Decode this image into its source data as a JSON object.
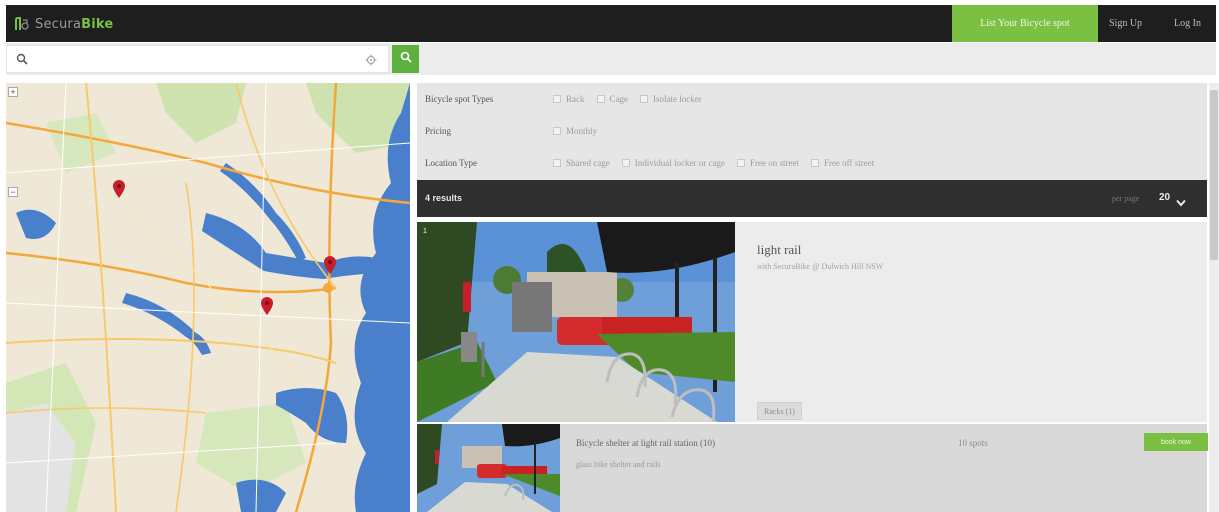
{
  "header": {
    "brand_light": "Secura",
    "brand_bold": "Bike",
    "cta_label": "List Your Bicycle spot",
    "signup_label": "Sign Up",
    "login_label": "Log In"
  },
  "search": {
    "value": "",
    "placeholder": ""
  },
  "filters": {
    "types": {
      "label": "Bicycle spot Types",
      "options": [
        "Rack",
        "Cage",
        "Isolate locker"
      ]
    },
    "pricing": {
      "label": "Pricing",
      "options": [
        "Monthly"
      ]
    },
    "location": {
      "label": "Location Type",
      "options": [
        "Shared cage",
        "Individual locker or cage",
        "Free on street",
        "Free off street"
      ]
    }
  },
  "results": {
    "count_label": "4 results",
    "per_page_label": "per page",
    "per_page_value": "20"
  },
  "listings": [
    {
      "index": "1",
      "title": "light rail",
      "subtitle": "with SecuraBike @ Dulwich Hill NSW",
      "tag": "Racks (1)"
    },
    {
      "title": "Bicycle shelter at light rail station (10)",
      "spots": "10 spots",
      "description": "glass bike shelter and rails",
      "button_label": "book now"
    }
  ],
  "colors": {
    "brand_green": "#7cc043",
    "dark_bar": "#1e1e1e",
    "results_bar": "#2f2f2f",
    "marker_red": "#c81e2a",
    "water": "#3f78c8"
  }
}
